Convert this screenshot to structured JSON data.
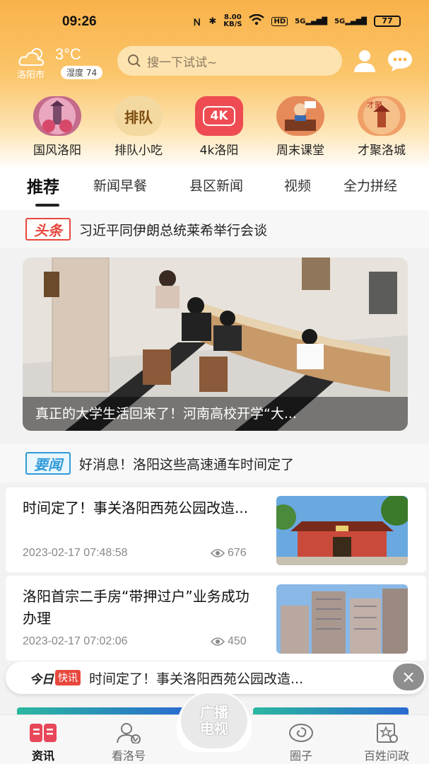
{
  "status": {
    "time": "09:26",
    "net_speed": "8.00",
    "net_unit": "KB/S",
    "hd": "HD",
    "sig1": "5G",
    "sig2": "5G",
    "battery": "77"
  },
  "weather": {
    "temp": "3°C",
    "city": "洛阳市",
    "humidity": "湿度 74"
  },
  "search": {
    "placeholder": "搜一下试试~"
  },
  "quick_links": [
    {
      "label": "国风洛阳"
    },
    {
      "label": "排队小吃",
      "glyph": "排队"
    },
    {
      "label": "4k洛阳",
      "glyph": "4K"
    },
    {
      "label": "周末课堂"
    },
    {
      "label": "才聚洛城",
      "glyph": "才聚"
    }
  ],
  "tabs": [
    "推荐",
    "新闻早餐",
    "县区新闻",
    "视频",
    "全力拼经"
  ],
  "headline": {
    "badge": "头条",
    "text": "习近平同伊朗总统莱希举行会谈"
  },
  "hero": {
    "caption": "真正的大学生活回来了！河南高校开学“大..."
  },
  "important": {
    "badge": "要闻",
    "text": "好消息！洛阳这些高速通车时间定了"
  },
  "articles": [
    {
      "title": "时间定了！事关洛阳西苑公园改造...",
      "date": "2023-02-17 07:48:58",
      "views": "676"
    },
    {
      "title": "洛阳首宗二手房“带押过户”业务成功办理",
      "date": "2023-02-17 07:02:06",
      "views": "450"
    }
  ],
  "flash": {
    "today": "今日",
    "tag": "快讯",
    "text": "时间定了！事关洛阳西苑公园改造...",
    "close": "×"
  },
  "bottom_nav": [
    {
      "label": "资讯"
    },
    {
      "label": "看洛号"
    },
    {
      "label": "圈子"
    },
    {
      "label": "百姓问政"
    }
  ],
  "center_button": {
    "line1": "广播",
    "line2": "电视"
  }
}
